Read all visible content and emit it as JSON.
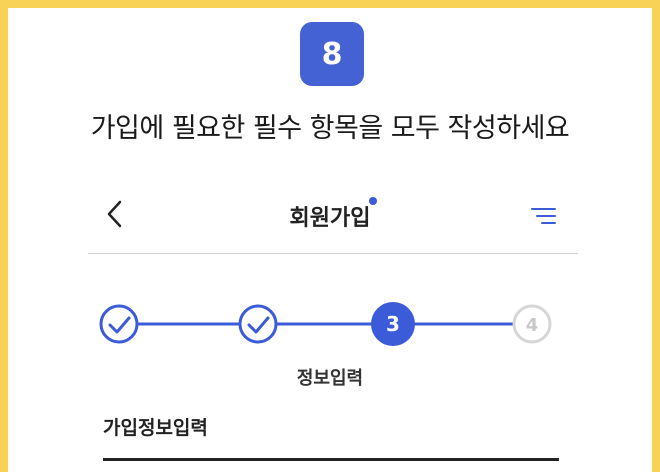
{
  "step_badge": "8",
  "instruction": "가입에 필요한 필수 항목을 모두 작성하세요",
  "header": {
    "back_icon": "chevron-left-icon",
    "title": "회원가입",
    "menu_icon": "menu-filter-icon"
  },
  "stepper": {
    "steps": [
      {
        "state": "done",
        "label": ""
      },
      {
        "state": "done",
        "label": ""
      },
      {
        "state": "current",
        "label": "3"
      },
      {
        "state": "pending",
        "label": "4"
      }
    ],
    "current_step_label": "정보입력"
  },
  "section": {
    "label": "가입정보입력"
  },
  "colors": {
    "accent": "#3b5bd9",
    "frame": "#f8d256",
    "pending": "#d6d6d6"
  }
}
